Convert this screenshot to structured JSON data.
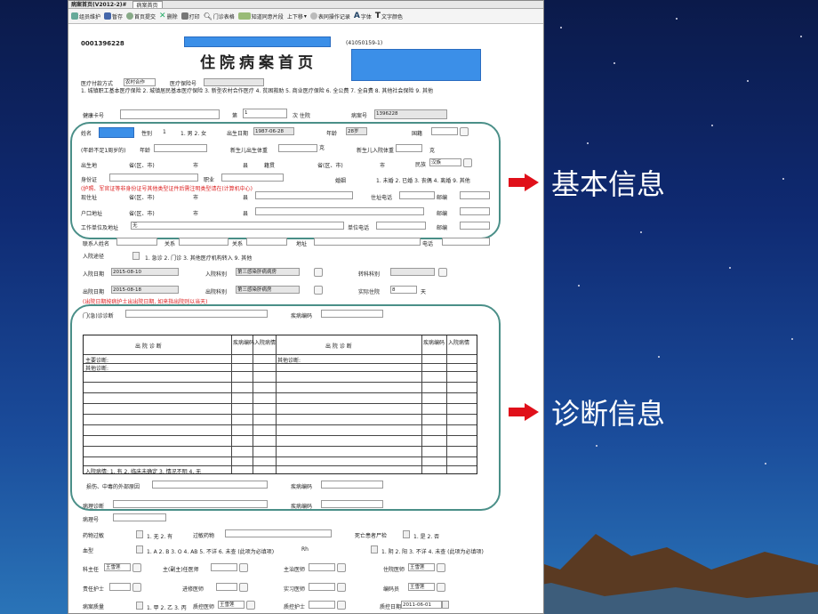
{
  "window": {
    "title": "病案首页(V2012-2)#",
    "tab": "病案首页"
  },
  "toolbar": [
    "组员维护",
    "暂存",
    "首页提交",
    "删除",
    "打印",
    "门诊表格",
    "知道同意片段",
    "上下移",
    "表同操作记录",
    "字体",
    "文字颜色"
  ],
  "record_no": "0001396228",
  "record_code": "(41050159-1)",
  "page_title": "住院病案首页",
  "payment": {
    "label": "医疗付款方式",
    "value": "农村合作",
    "insurance_label": "医疗保险号"
  },
  "payment_note": "1. 城镇职工基本医疗保险 2. 城镇居民基本医疗保险 3. 新型农村合作医疗 4. 贫困救助 5. 商业医疗保险 6. 全公费 7. 全自费 8. 其他社会保险 9. 其他",
  "row_card": {
    "card_label": "健康卡号",
    "times_label": "第",
    "times_value": "1",
    "times_suffix": "次 住院",
    "case_label": "病案号",
    "case_value": "1396228"
  },
  "basic": {
    "name": "姓名",
    "sex": "性别",
    "sex_val": "1",
    "sex_opts": "1. 男 2. 女",
    "birth": "出生日期",
    "birth_val": "1987-06-28",
    "age": "年龄",
    "age_val": "28岁",
    "nation": "国籍",
    "infant_age": "(年龄不足1周岁的)",
    "month": "年龄",
    "newborn_weight": "新生儿出生体重",
    "g": "克",
    "newborn_in": "新生儿入院体重",
    "birthplace": "出生地",
    "prov": "省(区、市)",
    "city": "市",
    "county": "县",
    "native": "籍贯",
    "ethnic": "民族",
    "ethnic_val": "汉族",
    "idcard": "身份证",
    "job": "职业",
    "marriage": "婚姻",
    "marriage_opts": "1. 未婚 2. 已婚 3. 丧偶 4. 离婚 9. 其他",
    "warn": "(护照、军官证等非身份证号其他类型证件后需注明类型请在(计算机中心)",
    "address": "现住址",
    "phone": "住址电话",
    "zip": "邮编",
    "hukou": "户口地址",
    "work": "工作单位及地址",
    "work_val": "无",
    "work_phone": "单位电话",
    "contact": "联系人姓名",
    "relation": "关系",
    "contact_addr": "地址",
    "contact_phone": "电话"
  },
  "admission": {
    "route": "入院途径",
    "route_opts": "1. 急诊 2. 门诊 3. 其他医疗机构转入 9. 其他",
    "in_date": "入院日期",
    "in_date_val": "2015-08-10",
    "in_dept": "入院科别",
    "in_dept_val": "第三感染肝病病房",
    "trans": "转科科别",
    "out_date": "出院日期",
    "out_date_val": "2015-08-18",
    "out_dept": "出院科别",
    "out_dept_val": "第三感染肝病房",
    "days": "实际住院",
    "days_val": "8",
    "day": "天",
    "out_note": "(出院日期按病护士出出院日期, 如来指出院则以当天)"
  },
  "diagnosis": {
    "clinic": "门(急)诊诊断",
    "code": "疾病编码",
    "col_diag": "出 院 诊 断",
    "col_code": "疾病编码",
    "col_state": "入院病情",
    "main": "主要诊断:",
    "other": "其他诊断:",
    "other2": "其他诊断:",
    "state_note": "入院病情: 1. 有 2. 临床未确定 3. 情况不明 4. 无",
    "injury": "损伤、中毒的外部原因",
    "path_diag": "病理诊断",
    "path_no": "病理号"
  },
  "allergy": {
    "drug": "药物过敏",
    "opts": "1. 无 2. 有",
    "allergic": "过敏药物",
    "autopsy": "死亡患者尸检",
    "autopsy_opts": "1. 是 2. 否",
    "blood": "血型",
    "blood_opts": "1. A 2. B 3. O 4. AB 5. 不详 6. 未查 (此项为必填项)",
    "rh": "Rh",
    "rh_opts": "1. 阴 2. 阳 3. 不详 4. 未查 (此项为必填项)"
  },
  "staff": {
    "director": "科主任",
    "director_val": "王雪莲",
    "chief": "主(副主)任医师",
    "attending": "主治医师",
    "resident": "住院医师",
    "resident_val": "王雪莲",
    "nurse": "责任护士",
    "advanced": "进修医师",
    "intern": "实习医师",
    "coder": "编码员",
    "coder_val": "王雪莲",
    "quality": "病案质量",
    "quality_opts": "1. 甲 2. 乙 3. 丙",
    "qc_doc": "质控医师",
    "qc_doc_val": "王雪莲",
    "qc_nurse": "质控护士",
    "qc_date": "质控日期",
    "qc_date_val": "2011-06-01"
  },
  "callouts": [
    "基本信息",
    "诊断信息"
  ],
  "colors": {
    "callout_arrow": "#e0101a",
    "highlight_box": "#3b8fe8",
    "round_border": "#4a8f88"
  }
}
